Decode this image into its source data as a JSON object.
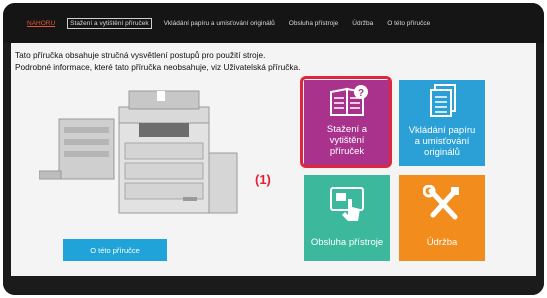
{
  "nav": {
    "items": [
      {
        "label": "NAHORU"
      },
      {
        "label": "Stažení a vytištění příruček"
      },
      {
        "label": "Vkládání papíru a umisťování originálů"
      },
      {
        "label": "Obsluha přístroje"
      },
      {
        "label": "Údržba"
      },
      {
        "label": "O této příručce"
      }
    ]
  },
  "intro": {
    "line1": "Tato příručka obsahuje stručná vysvětlení postupů pro použití stroje.",
    "line2": "Podrobné informace, které tato příručka neobsahuje, viz Uživatelská příručka."
  },
  "about_button": "O této příručce",
  "tiles": {
    "download": {
      "line1": "Stažení a",
      "line2": "vytištění",
      "line3": "příruček"
    },
    "loading": {
      "line1": "Vkládání papíru",
      "line2": "a umisťování",
      "line3": "originálů"
    },
    "operation": {
      "label": "Obsluha přístroje"
    },
    "maintenance": {
      "label": "Údržba"
    }
  },
  "callout": "(1)",
  "colors": {
    "download": "#a8328c",
    "loading": "#2aa0d6",
    "operation": "#3cb89d",
    "maintenance": "#f28c1d",
    "highlight": "#e1253c",
    "about_button": "#1fa3d8"
  },
  "icons": {
    "download": "book-help-icon",
    "loading": "paper-stack-icon",
    "operation": "touch-panel-icon",
    "maintenance": "tools-icon"
  }
}
